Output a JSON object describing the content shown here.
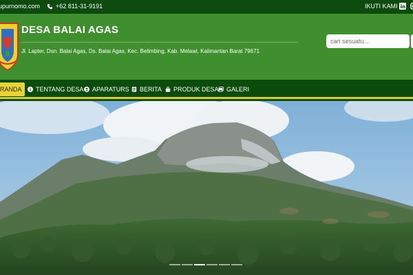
{
  "topbar": {
    "email": "upurnomo.com",
    "phone": "+62 811-31-9191",
    "follow_label": "IKUTI KAMI :",
    "social_icons": [
      "linkedin-icon",
      "instagram-icon"
    ]
  },
  "header": {
    "title": "DESA BALAI AGAS",
    "address": "Jl. Lapter, Dsn. Balai Agas, Ds. Balai Agas, Kec. Belimbing, Kab. Melawi, Kalimantan Barat 79671",
    "search_placeholder": "cari sesuatu..."
  },
  "nav": {
    "items": [
      {
        "label": "RANDA",
        "icon": "home-icon",
        "active": true
      },
      {
        "label": "TENTANG DESA",
        "icon": "info-icon"
      },
      {
        "label": "APARATURS",
        "icon": "user-icon"
      },
      {
        "label": "BERITA",
        "icon": "news-icon"
      },
      {
        "label": "PRODUK DESA",
        "icon": "shopping-bag-icon"
      },
      {
        "label": "GALERI",
        "icon": "gallery-icon"
      }
    ]
  },
  "hero": {
    "slide_count": 6,
    "active_slide": 3
  },
  "colors": {
    "topbar": "#0d4a0d",
    "header": "#3f8f2f",
    "nav": "#0b4b0b",
    "accent": "#e8d43a"
  }
}
